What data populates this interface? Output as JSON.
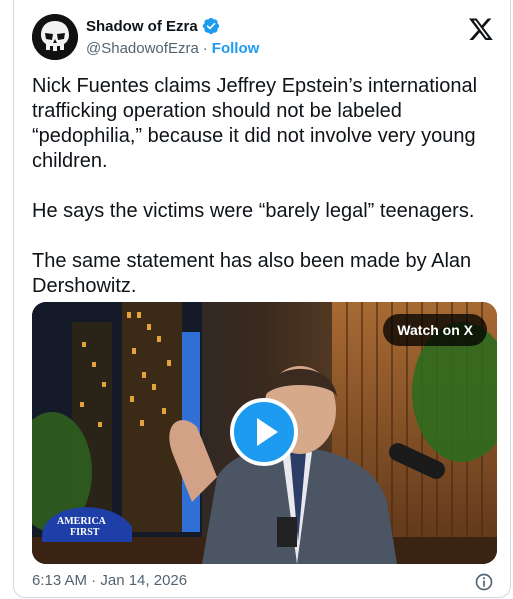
{
  "author": {
    "name": "Shadow of Ezra",
    "handle": "@ShadowofEzra",
    "separator": "·",
    "follow_label": "Follow"
  },
  "tweet": {
    "text": "Nick Fuentes claims Jeffrey Epstein’s international trafficking operation should not be labeled “pedophilia,” because it did not involve very young children.\n\nHe says the victims were “barely legal” teenagers.\n\nThe same statement has also been made by Alan Dershowitz."
  },
  "media": {
    "watch_label": "Watch on X",
    "cap_text_line1": "AMERICA",
    "cap_text_line2": "FIRST"
  },
  "footer": {
    "timestamp": "6:13 AM · Jan 14, 2026"
  },
  "colors": {
    "accent": "#1d9bf0",
    "text": "#0f1419",
    "muted": "#536471"
  },
  "icons": [
    "verified-badge-icon",
    "x-logo-icon",
    "play-icon",
    "info-icon"
  ]
}
